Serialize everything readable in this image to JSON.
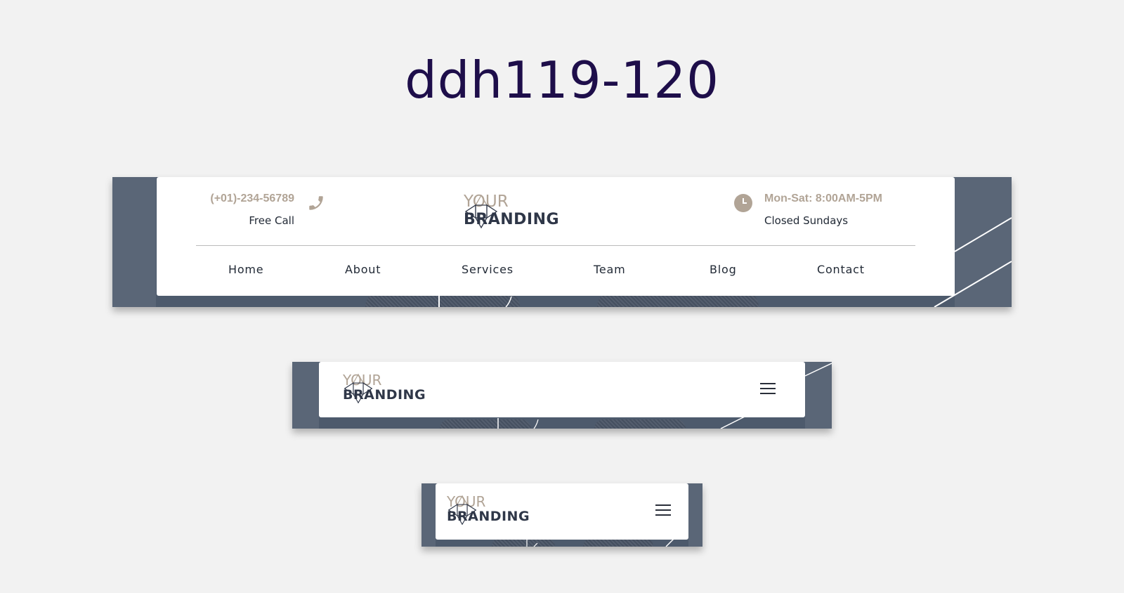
{
  "page": {
    "title": "ddh119-120"
  },
  "brand": {
    "line1": "YOUR",
    "line2": "BRANDING"
  },
  "header_large": {
    "phone": {
      "number": "(+01)-234-56789",
      "sub": "Free Call",
      "icon": "phone-icon"
    },
    "hours": {
      "text": "Mon-Sat: 8:00AM-5PM",
      "sub": "Closed Sundays",
      "icon": "clock-icon"
    },
    "nav": [
      "Home",
      "About",
      "Services",
      "Team",
      "Blog",
      "Contact"
    ]
  },
  "header_medium": {
    "menu_icon": "hamburger-menu-icon"
  },
  "header_small": {
    "menu_icon": "hamburger-menu-icon"
  },
  "colors": {
    "background": "#f2f2f2",
    "title": "#1e0e4a",
    "accent": "#b1a496",
    "dark": "#2f3748",
    "backdrop": "#4d5a6c"
  }
}
